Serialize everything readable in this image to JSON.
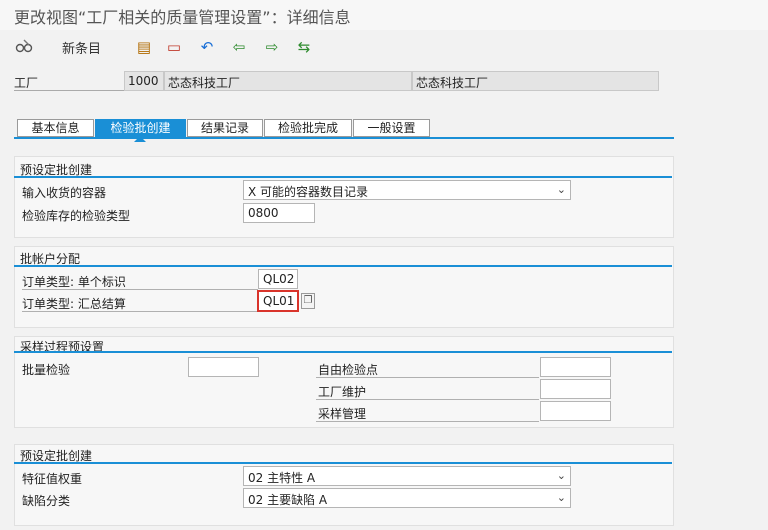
{
  "window": {
    "title": "更改视图“工厂相关的质量管理设置”：详细信息"
  },
  "toolbar": {
    "display_change_icon": "glasses-pencil-icon",
    "new_entries_label": "新条目",
    "buttons": [
      {
        "name": "copy-as-icon",
        "glyph": "▤",
        "color": "#b06a00"
      },
      {
        "name": "delete-icon",
        "glyph": "▭",
        "color": "#c0392b"
      },
      {
        "name": "undo-icon",
        "glyph": "↶",
        "color": "#1a6fd6"
      },
      {
        "name": "previous-entry-icon",
        "glyph": "⇦",
        "color": "#2e8b2e"
      },
      {
        "name": "next-entry-icon",
        "glyph": "⇨",
        "color": "#2e8b2e"
      },
      {
        "name": "select-block-icon",
        "glyph": "⇆",
        "color": "#2e8b2e"
      }
    ]
  },
  "header": {
    "plant_label": "工厂",
    "plant_code": "1000",
    "plant_name": "芯态科技工厂",
    "plant_name2": "芯态科技工厂"
  },
  "tabs": [
    {
      "label": "基本信息",
      "active": false
    },
    {
      "label": "检验批创建",
      "active": true
    },
    {
      "label": "结果记录",
      "active": false
    },
    {
      "label": "检验批完成",
      "active": false
    },
    {
      "label": "一般设置",
      "active": false
    }
  ],
  "section1": {
    "title": "预设定批创建",
    "receipt_container_label": "输入收货的容器",
    "receipt_container_value": "X 可能的容器数目记录",
    "stock_insp_type_label": "检验库存的检验类型",
    "stock_insp_type_value": "0800"
  },
  "section2": {
    "title": "批帐户分配",
    "order_type_single_label": "订单类型: 单个标识",
    "order_type_single_value": "QL02",
    "order_type_collective_label": "订单类型: 汇总结算",
    "order_type_collective_value": "QL01"
  },
  "section3": {
    "title": "采样过程预设置",
    "bulk_insp_label": "批量检验",
    "bulk_insp_value": "",
    "free_insp_point_label": "自由检验点",
    "free_insp_point_value": "",
    "plant_maint_label": "工厂维护",
    "plant_maint_value": "",
    "sample_mgmt_label": "采样管理",
    "sample_mgmt_value": ""
  },
  "section4": {
    "title": "预设定批创建",
    "char_weight_label": "特征值权重",
    "char_weight_value": "02 主特性 A",
    "defect_class_label": "缺陷分类",
    "defect_class_value": "02 主要缺陷 A"
  }
}
